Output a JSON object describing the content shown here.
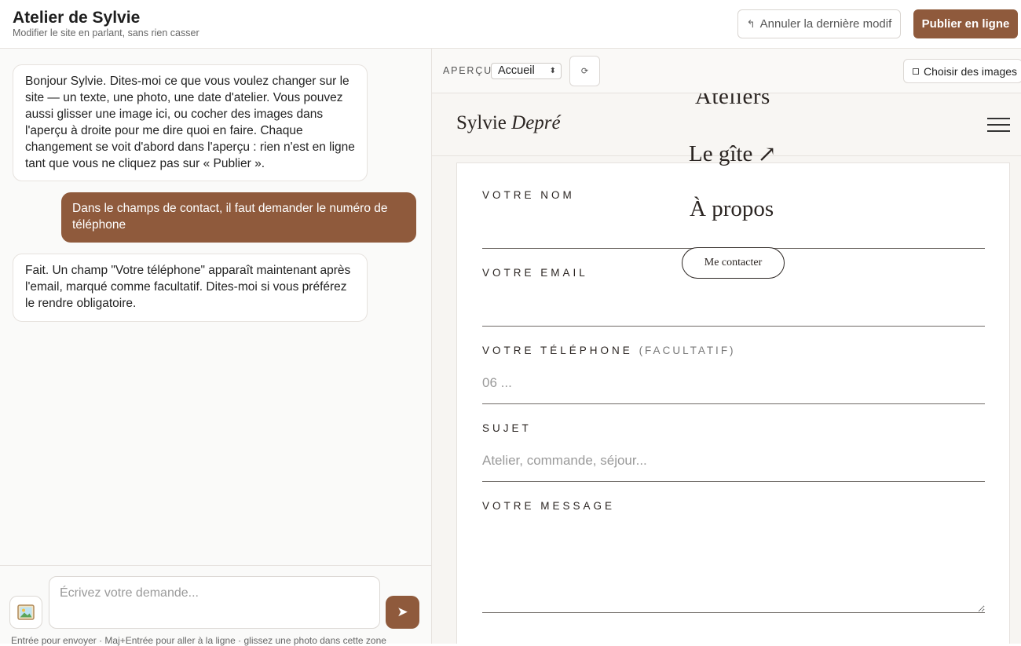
{
  "header": {
    "title": "Atelier de Sylvie",
    "subtitle": "Modifier le site en parlant, sans rien casser",
    "undo_label": "Annuler la dernière modif",
    "publish_label": "Publier en ligne"
  },
  "chat": {
    "messages": [
      {
        "role": "assistant",
        "text": "Bonjour Sylvie. Dites-moi ce que vous voulez changer sur le site — un texte, une photo, une date d'atelier. Vous pouvez aussi glisser une image ici, ou cocher des images dans l'aperçu à droite pour me dire quoi en faire. Chaque changement se voit d'abord dans l'aperçu : rien n'est en ligne tant que vous ne cliquez pas sur « Publier »."
      },
      {
        "role": "user",
        "text": "Dans le champs de contact, il faut demander le numéro de téléphone"
      },
      {
        "role": "assistant",
        "text": "Fait. Un champ \"Votre téléphone\" apparaît maintenant après l'email, marqué comme facultatif. Dites-moi si vous préférez le rendre obligatoire."
      }
    ],
    "input_placeholder": "Écrivez votre demande...",
    "hint": "Entrée pour envoyer · Maj+Entrée pour aller à la ligne · glissez une photo dans cette zone"
  },
  "preview": {
    "label": "APERÇU",
    "page_select": "Accueil",
    "refresh_icon": "⟳",
    "images_button": "Choisir des images",
    "site": {
      "brand_first": "Sylvie",
      "brand_last": "Depré",
      "menu": [
        "Ateliers",
        "Le gîte",
        "À propos"
      ],
      "menu_arrow": "↗",
      "contact_button": "Me contacter",
      "form": {
        "name_label": "VOTRE NOM",
        "email_label": "VOTRE EMAIL",
        "phone_label": "VOTRE TÉLÉPHONE",
        "phone_optional": "(FACULTATIF)",
        "phone_placeholder": "06 ...",
        "subject_label": "SUJET",
        "subject_placeholder": "Atelier, commande, séjour...",
        "message_label": "VOTRE MESSAGE"
      }
    }
  },
  "colors": {
    "accent": "#8f5a3c",
    "border": "#e6e2de",
    "text": "#222222"
  }
}
